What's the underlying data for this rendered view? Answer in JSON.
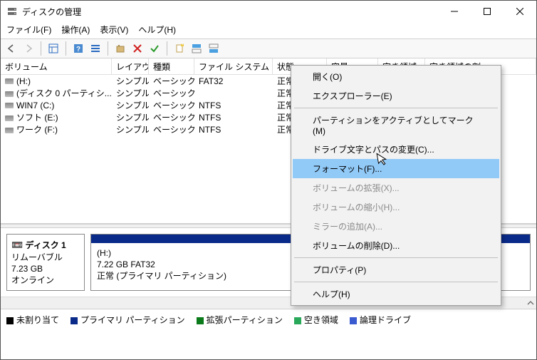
{
  "window": {
    "title": "ディスクの管理"
  },
  "menubar": {
    "file": "ファイル(F)",
    "action": "操作(A)",
    "view": "表示(V)",
    "help": "ヘルプ(H)"
  },
  "columns": {
    "volume": "ボリューム",
    "layout": "レイアウト",
    "type": "種類",
    "filesystem": "ファイル システム",
    "status": "状態",
    "capacity": "容量",
    "freespace": "空き領域",
    "freepct": "空き領域の割..."
  },
  "volumes": [
    {
      "name": "(H:)",
      "layout": "シンプル",
      "type": "ベーシック",
      "fs": "FAT32",
      "status": "正常"
    },
    {
      "name": "(ディスク 0 パーティシ...",
      "layout": "シンプル",
      "type": "ベーシック",
      "fs": "",
      "status": "正常"
    },
    {
      "name": "WIN7 (C:)",
      "layout": "シンプル",
      "type": "ベーシック",
      "fs": "NTFS",
      "status": "正常"
    },
    {
      "name": "ソフト (E:)",
      "layout": "シンプル",
      "type": "ベーシック",
      "fs": "NTFS",
      "status": "正常"
    },
    {
      "name": "ワーク (F:)",
      "layout": "シンプル",
      "type": "ベーシック",
      "fs": "NTFS",
      "status": "正常"
    }
  ],
  "context_menu": {
    "open": "開く(O)",
    "explorer": "エクスプローラー(E)",
    "mark_active": "パーティションをアクティブとしてマーク(M)",
    "change_letter": "ドライブ文字とパスの変更(C)...",
    "format": "フォーマット(F)...",
    "extend": "ボリュームの拡張(X)...",
    "shrink": "ボリュームの縮小(H)...",
    "add_mirror": "ミラーの追加(A)...",
    "delete": "ボリュームの削除(D)...",
    "properties": "プロパティ(P)",
    "help": "ヘルプ(H)"
  },
  "disk_panel": {
    "disk_label": "ディスク 1",
    "media": "リムーバブル",
    "size": "7.23 GB",
    "status": "オンライン",
    "partition": {
      "label": "(H:)",
      "detail": "7.22 GB FAT32",
      "state": "正常 (プライマリ パーティション)"
    }
  },
  "legend": {
    "unallocated": "未割り当て",
    "primary": "プライマリ パーティション",
    "extended": "拡張パーティション",
    "free": "空き領域",
    "logical": "論理ドライブ"
  },
  "colors": {
    "unallocated": "#000000",
    "primary": "#0a2a8a",
    "extended": "#0a7a1a",
    "free": "#2aa85a",
    "logical": "#3a5ad0"
  }
}
